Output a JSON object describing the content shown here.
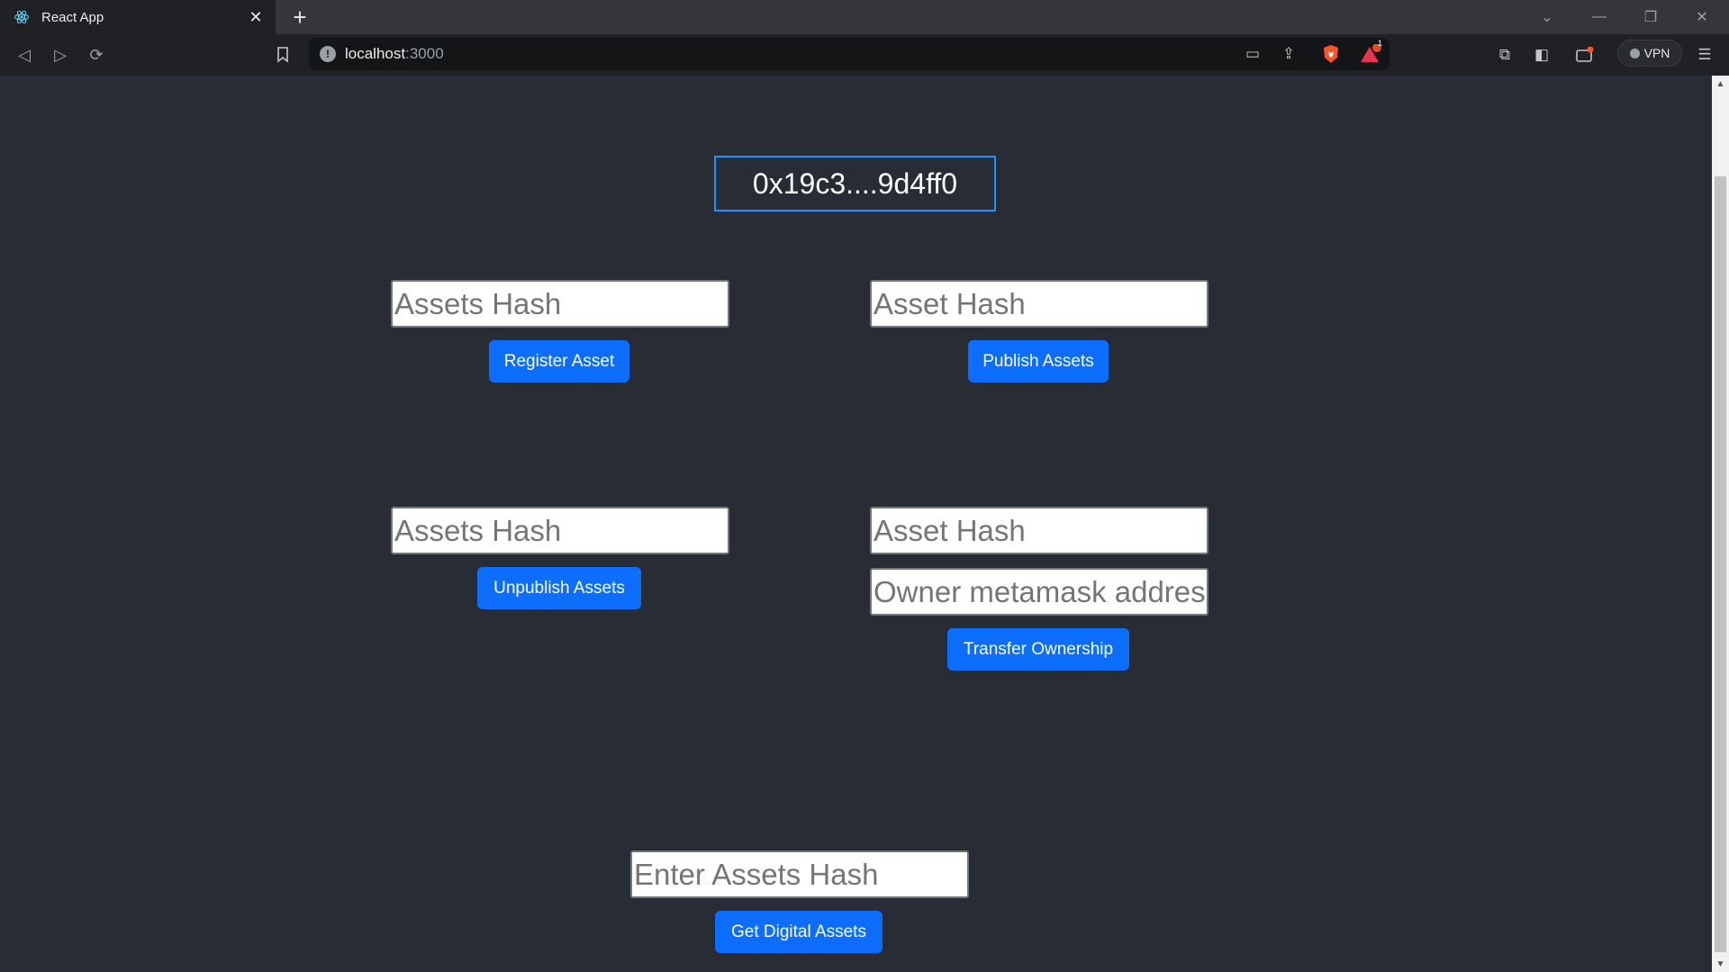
{
  "browser": {
    "tab_title": "React App",
    "url_host": "localhost",
    "url_port": ":3000",
    "vpn_label": "VPN",
    "notification_count": "1"
  },
  "page": {
    "account_address": "0x19c3....9d4ff0",
    "register": {
      "placeholder": "Assets Hash",
      "button": "Register Asset"
    },
    "publish": {
      "placeholder": "Asset Hash",
      "button": "Publish Assets"
    },
    "unpublish": {
      "placeholder": "Assets Hash",
      "button": "Unpublish Assets"
    },
    "transfer": {
      "hash_placeholder": "Asset Hash",
      "owner_placeholder": "Owner metamask address",
      "button": "Transfer Ownership"
    },
    "get": {
      "placeholder": "Enter Assets Hash",
      "button": "Get Digital Assets"
    }
  },
  "colors": {
    "page_background": "#282c34",
    "button_primary": "#0d6efd",
    "address_border": "#1e90ff"
  }
}
